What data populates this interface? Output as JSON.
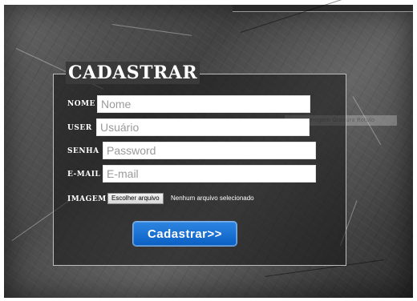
{
  "form": {
    "legend": "CADASTRAR",
    "labels": {
      "nome": "NOME",
      "user": "USER",
      "senha": "SENHA",
      "email": "E-MAIL",
      "imagem": "IMAGEM"
    },
    "placeholders": {
      "nome": "Nome",
      "user": "Usuário",
      "senha": "Password",
      "email": "E-mail"
    },
    "file_button_label": "Escolher arquivo",
    "file_status": "Nenhum arquivo selecionado",
    "submit_label": "Cadastrar>>"
  },
  "ghost_tooltip": "Inserir Imagem Gravura Rotulo",
  "colors": {
    "submit_blue": "#0a5fc4",
    "panel_border": "#bdbdbd",
    "label_text": "#ffffff"
  }
}
